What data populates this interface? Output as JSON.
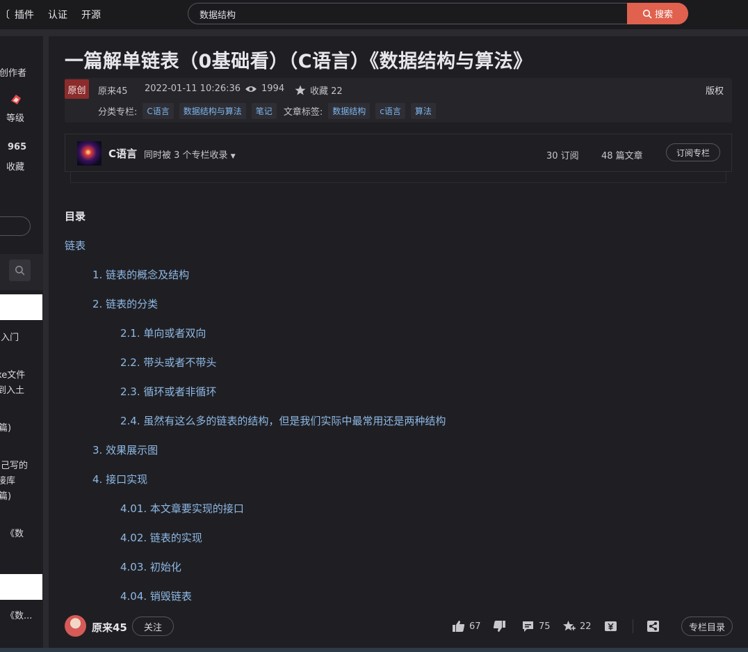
{
  "topnav": {
    "partial_left": "〔",
    "items": [
      "插件",
      "认证",
      "开源"
    ]
  },
  "search": {
    "value": "数据结构",
    "button_label": "搜索"
  },
  "left_sidebar": {
    "frag_creator": "星创作者",
    "frag_level": "等级",
    "frag_fav_count": "965",
    "frag_fav_label": "收藏",
    "frag_list": [
      "(入门",
      "xe文件",
      "到入土",
      "篇)",
      "己写的",
      "接库",
      "篇)",
      "《数",
      "《数..."
    ]
  },
  "article": {
    "title": "一篇解单链表（0基础看）（C语言）《数据结构与算法》",
    "original_badge": "原创",
    "author": "原来45",
    "datetime": "2022-01-11 10:26:36",
    "views": "1994",
    "favorites_label": "收藏 22",
    "copyright": "版权",
    "category_label": "分类专栏:",
    "categories": [
      "C语言",
      "数据结构与算法",
      "笔记"
    ],
    "tags_label": "文章标签:",
    "tags": [
      "数据结构",
      "c语言",
      "算法"
    ]
  },
  "column_card": {
    "name": "C语言",
    "sub_text": "同时被 3 个专栏收录",
    "subscribers": "30 订阅",
    "articles": "48 篇文章",
    "subscribe_button": "订阅专栏"
  },
  "toc": {
    "title": "目录",
    "items": [
      {
        "label": "链表",
        "level": 0
      },
      {
        "label": "1. 链表的概念及结构",
        "level": 1
      },
      {
        "label": "2. 链表的分类",
        "level": 1
      },
      {
        "label": "2.1. 单向或者双向",
        "level": 2
      },
      {
        "label": "2.2. 带头或者不带头",
        "level": 2
      },
      {
        "label": "2.3. 循环或者非循环",
        "level": 2
      },
      {
        "label": "2.4. 虽然有这么多的链表的结构，但是我们实际中最常用还是两种结构",
        "level": 2
      },
      {
        "label": "3. 效果展示图",
        "level": 1
      },
      {
        "label": "4. 接口实现",
        "level": 1
      },
      {
        "label": "4.01. 本文章要实现的接口",
        "level": 2
      },
      {
        "label": "4.02. 链表的实现",
        "level": 2
      },
      {
        "label": "4.03. 初始化",
        "level": 2
      },
      {
        "label": "4.04. 销毁链表",
        "level": 2
      }
    ]
  },
  "bottom_bar": {
    "author": "原来45",
    "follow_button": "关注",
    "likes": "67",
    "comments": "75",
    "favorites": "22",
    "column_toc_button": "专栏目录"
  },
  "colors": {
    "accent": "#e0614e",
    "link": "#8fb9e6",
    "tag_text": "#7eb6f0",
    "original_badge": "#8b2b2b",
    "background": "#1f1f23"
  }
}
